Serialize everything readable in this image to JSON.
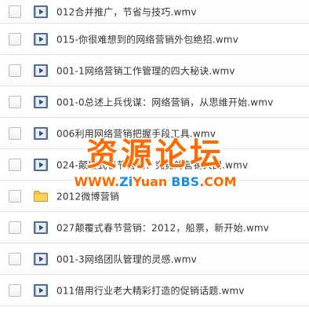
{
  "files": [
    {
      "name": "012合并推广，节省与技巧.wmv",
      "icon": "video-file-icon"
    },
    {
      "name": "015-你很难想到的网络营销外包绝招.wmv",
      "icon": "video-file-icon"
    },
    {
      "name": "001-1网络营销工作管理的四大秘诀.wmv",
      "icon": "video-file-icon"
    },
    {
      "name": "001-0总述上兵伐谋：网络营销，从思维开始.wmv",
      "icon": "video-file-icon"
    },
    {
      "name": "006利用网络营销把握手段工具.wmv",
      "icon": "video-file-icon"
    },
    {
      "name": "024-颠覆式春节营销：究竟的营销大田.wmv",
      "icon": "video-file-icon"
    },
    {
      "name": "2012微博营销",
      "icon": "folder-icon"
    },
    {
      "name": "027颠覆式春节营销：2012，船票，新开始.wmv",
      "icon": "video-file-icon"
    },
    {
      "name": "001-3网络团队管理的灵感.wmv",
      "icon": "video-file-icon"
    },
    {
      "name": "011借用行业老大精彩打造的促销话题.wmv",
      "icon": "video-file-icon"
    }
  ],
  "watermark": {
    "title": "资源论坛",
    "site_www": "WWW.",
    "site_zi": "Zi",
    "site_yuan": "Yuan",
    "site_bbs": "BBS",
    "site_com": ".COM"
  },
  "colors": {
    "video_icon": "#5a7fb0",
    "folder_icon": "#f0c040",
    "watermark_orange": "#ff6a00",
    "watermark_blue": "#1e8fe0"
  }
}
